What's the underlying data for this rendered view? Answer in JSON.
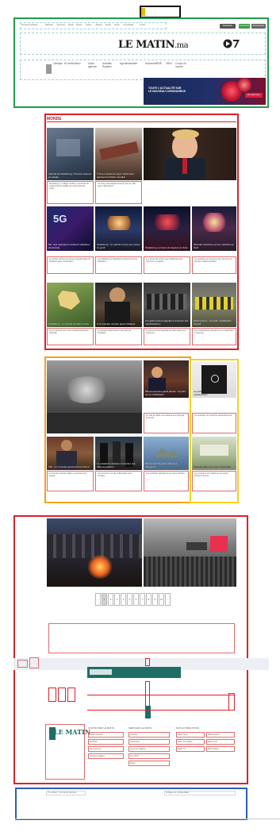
{
  "header": {
    "top_links": [
      "Dernières Actualités",
      "Nationale",
      "Économie",
      "Monde",
      "Société",
      "Culture",
      "Régions",
      "Emploi",
      "Sports",
      "Universalités",
      "Comité"
    ],
    "buttons": {
      "newsletter": "Newsletter",
      "signin": "Connexion",
      "subscribe": "Abonnement"
    },
    "logo": "LE MATIN",
    "logo_suffix": ".ma",
    "nav_items": [
      "Lifestyle",
      "En texte",
      "Maroc",
      "Salon agricole",
      "Activités Royales",
      "Agroalimentaire",
      "Monarchie",
      "PME",
      "2M24",
      "Coupe du monde"
    ],
    "banner_text": [
      "TOUTE L'ACTUALITÉ SUR",
      "LE NOUVEAU CORONAVIRUS"
    ],
    "banner_button": "En savoir plus"
  },
  "section": {
    "title": "MONDE"
  },
  "articles": {
    "r1": [
      {
        "caption": "Attentat de Strasbourg: l'homme suspect en cavale",
        "excerpt": "Strasbourg, un village, fouille en poursuite du suspect de la fusillade qui a fait plusieurs morts."
      },
      {
        "caption": "Trump a plusieurs pays maintenant approuvé le Pacte mondial",
        "excerpt": "Ce texte a été adopté lundi par plus de 150 pays à Marrakech."
      },
      {
        "caption": "",
        "excerpt": ""
      }
    ],
    "r2": [
      {
        "caption": "5G : des opérateurs arrêtent l'utilisation de Huawei",
        "excerpt": "Le groupe chinois est accusé d'espionnage par plusieurs pays occidentaux."
      },
      {
        "caption": "Strasbourg : le marché rouvre ses portes ce jeudi",
        "excerpt": "Les habitants de Strasbourg reprennent leurs habitudes."
      },
      {
        "caption": "Strasbourg, le tireur est toujours en fuite",
        "excerpt": "Les forces de l'ordre sont mobilisées pour retrouver le suspect."
      },
      {
        "caption": "Sécurité renforcée sur les marchés de Noël",
        "excerpt": "Les autorités ont annoncé des mesures de sécurité supplémentaires."
      }
    ],
    "r3": [
      {
        "caption": "Strasbourg : le marché de Noël rouvre",
        "excerpt": "La vie reprend son cours à Strasbourg après l'attentat."
      },
      {
        "caption": "Une enquête ouverte après l'attaque",
        "excerpt": "Le parquet antiterroriste a été saisi de l'enquête."
      },
      {
        "caption": "Les gilets jaunes appelés à renoncer aux manifestations",
        "excerpt": "Le gouvernement appelle au calme après les annonces."
      },
      {
        "caption": "Gilets jaunes : nouvelle mobilisation samedi",
        "excerpt": "Les manifestants prévoient de se rassembler à nouveau."
      }
    ],
    "r4": [
      {
        "caption": "",
        "excerpt": ""
      },
      {
        "caption": "Mouvement des gilets jaunes : le point sur la mobilisation",
        "excerpt": "Le chef de l'État s'est adressé aux Français lundi soir."
      },
      {
        "caption": "La justice ordonne l'arrêt de la manifestation",
        "excerpt": "Les autorités ont interdit le rassemblement."
      }
    ],
    "r5": [
      {
        "caption": "Irak : un nouveau gouvernement formé",
        "excerpt": "Le Premier ministre irakien a présenté son équipe."
      },
      {
        "caption": "Le président ukrainien rencontre ses alliés européens",
        "excerpt": "La rencontre a eu lieu à Bruxelles cette semaine."
      },
      {
        "caption": "Mouvement de grève dans les transports",
        "excerpt": "Les syndicats appellent à une grève illimitée."
      },
      {
        "caption": "Incendie dans une zone industrielle",
        "excerpt": "Les pompiers ont maîtrisé le feu après plusieurs heures."
      }
    ]
  },
  "pagination": [
    "‹",
    "1",
    "2",
    "3",
    "4",
    "5",
    "6",
    "7",
    "8",
    "9",
    "10",
    "›"
  ],
  "footer": {
    "logo": "LE MATIN",
    "col_titles": [
      "CONTACTER LE MATIN",
      "SERVICES LE MATIN",
      "NOS AUTRES SITES"
    ],
    "col1": [
      "Nous contacter",
      "Publicité",
      "Abonnement",
      "Mentions légales"
    ],
    "col2": [
      "Archives",
      "Newsletter",
      "Annonces légales",
      "Flux RSS",
      "Météo"
    ],
    "col3": [
      "Matin Sport",
      "Matin Emploi",
      "Matin Immobilier",
      "Matin Auto",
      "Matin TV",
      "Matin Radio"
    ],
    "copyright": "© Le Matin - Tous droits réservés",
    "bottom_note": "Politique de confidentialité"
  }
}
